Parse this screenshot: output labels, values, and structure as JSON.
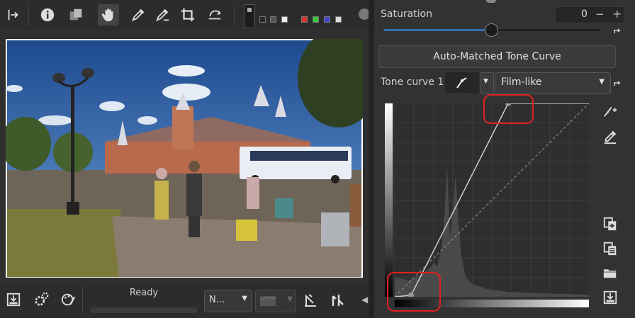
{
  "toolbar": {
    "icons": [
      "panel-toggle-icon",
      "info-icon",
      "before-after-icon",
      "hand-icon",
      "color-picker-icon",
      "white-balance-picker-icon",
      "crop-icon",
      "straighten-icon"
    ],
    "color_swatches": [
      "#3a3a3a",
      "#3a3a3a",
      "#3a3a3a",
      "#e0e0e0",
      "#d33",
      "#3c3",
      "#44c",
      "#ddd"
    ]
  },
  "status": {
    "text": "Ready"
  },
  "bottom": {
    "select_value": "N..."
  },
  "saturation": {
    "label": "Saturation",
    "value": "0",
    "minus": "−",
    "plus": "+",
    "level": 0.5
  },
  "amtc": {
    "label": "Auto-Matched Tone Curve"
  },
  "tone_curve": {
    "label": "Tone curve 1:",
    "mode": "Film-like"
  },
  "colors": {
    "accent": "#2f6fb3",
    "highlight": "#e02020"
  }
}
